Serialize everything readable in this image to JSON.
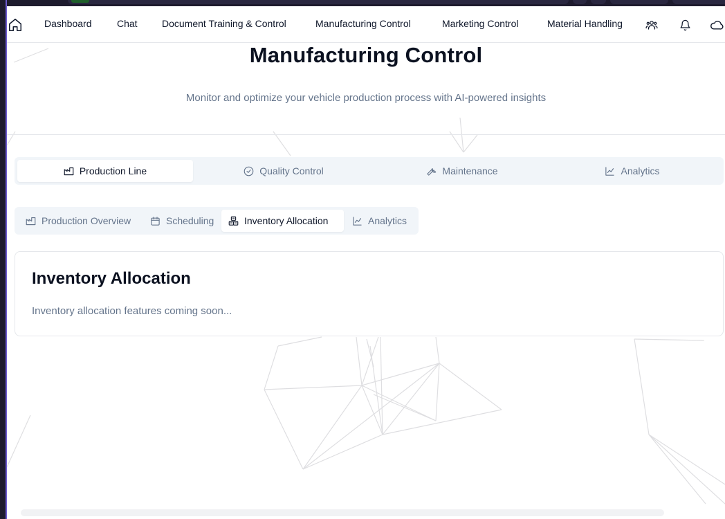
{
  "nav": {
    "items": [
      {
        "label": "Dashboard"
      },
      {
        "label": "Chat"
      },
      {
        "label": "Document Training & Control"
      },
      {
        "label": "Manufacturing Control"
      },
      {
        "label": "Marketing Control"
      },
      {
        "label": "Material Handling"
      }
    ],
    "icons": [
      "home-icon",
      "users-icon",
      "bell-icon",
      "cloud-icon"
    ]
  },
  "header": {
    "title": "Manufacturing Control",
    "subtitle": "Monitor and optimize your vehicle production process with AI-powered insights"
  },
  "main_tabs": [
    {
      "label": "Production Line",
      "icon": "factory-icon",
      "active": true
    },
    {
      "label": "Quality Control",
      "icon": "check-circle-icon",
      "active": false
    },
    {
      "label": "Maintenance",
      "icon": "wrench-icon",
      "active": false
    },
    {
      "label": "Analytics",
      "icon": "line-chart-icon",
      "active": false
    }
  ],
  "sub_tabs": [
    {
      "label": "Production Overview",
      "icon": "factory-icon",
      "active": false
    },
    {
      "label": "Scheduling",
      "icon": "calendar-icon",
      "active": false
    },
    {
      "label": "Inventory Allocation",
      "icon": "boxes-icon",
      "active": true
    },
    {
      "label": "Analytics",
      "icon": "line-chart-icon",
      "active": false
    }
  ],
  "card": {
    "title": "Inventory Allocation",
    "body": "Inventory allocation features coming soon..."
  },
  "colors": {
    "text_primary": "#0f172a",
    "text_muted": "#64748b",
    "tab_bg": "#f1f5f9",
    "border": "#e5e7eb"
  }
}
